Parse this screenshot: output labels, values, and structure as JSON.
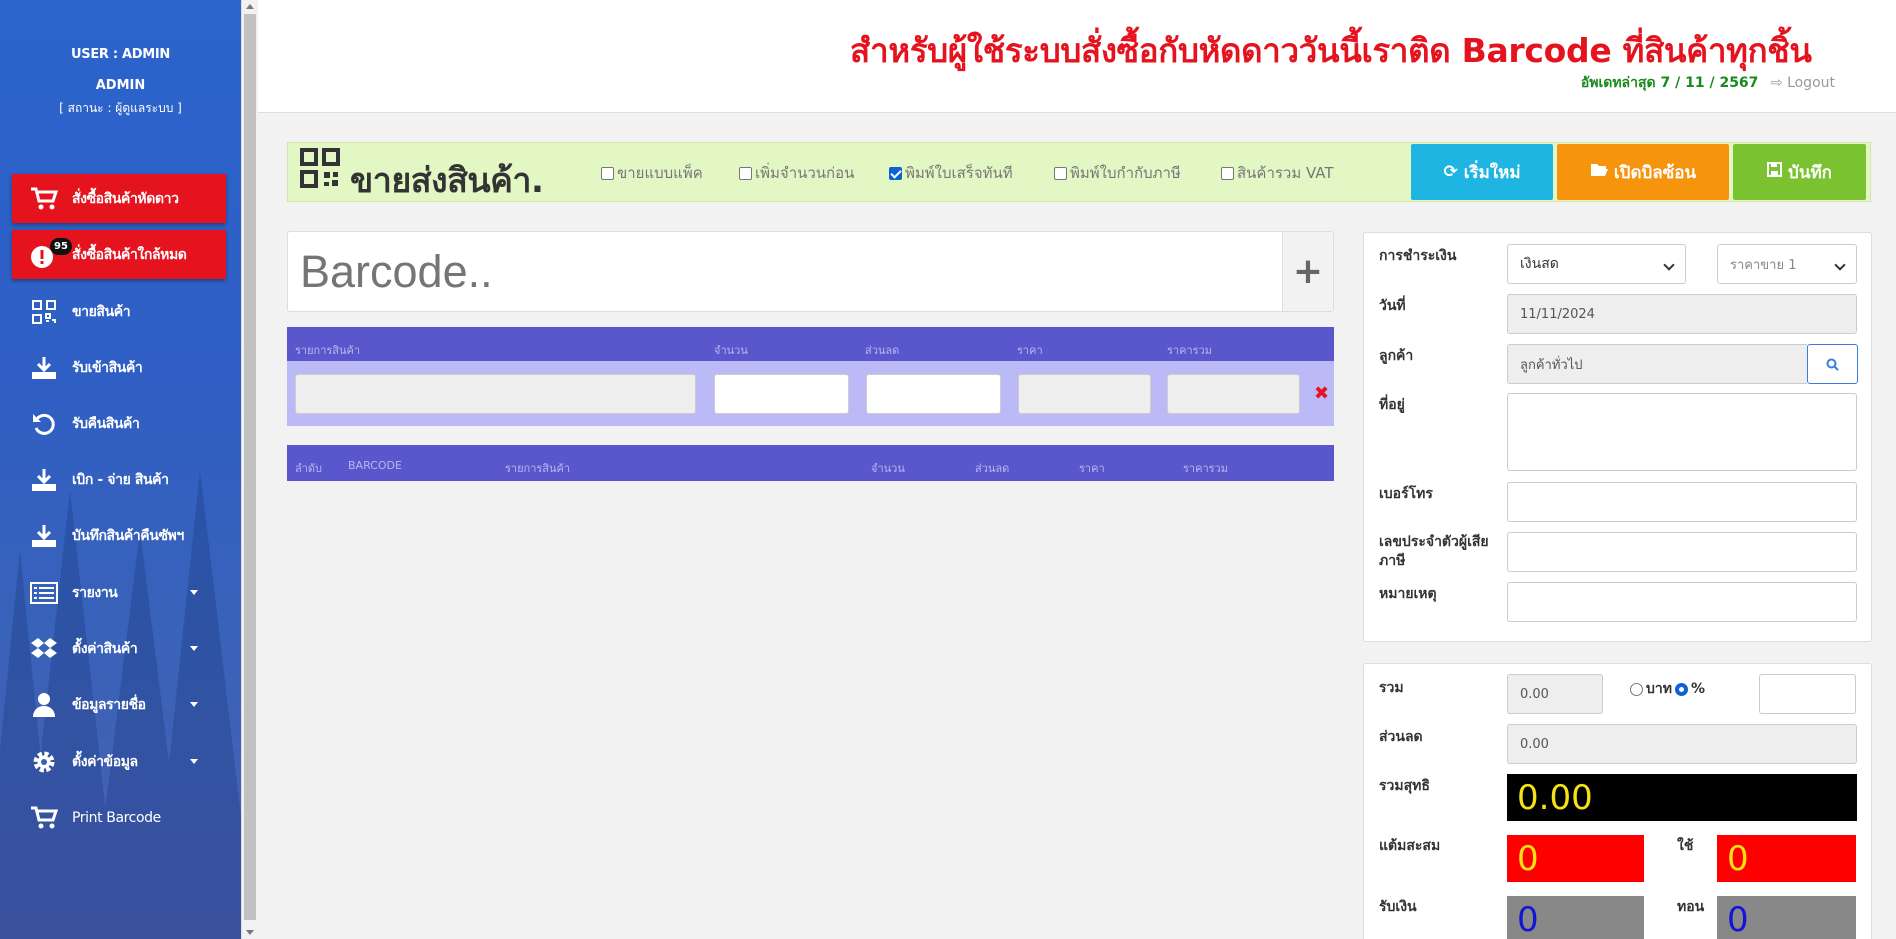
{
  "user": {
    "line1": "USER : ADMIN",
    "line2": "ADMIN",
    "status": "[ สถานะ : ผู้ดูแลระบบ ]"
  },
  "menu": [
    {
      "label": "สั่งซื้อสินค้าหัดดาว",
      "icon": "cart-icon"
    },
    {
      "label": "สั่งซื้อสินค้าใกล้หมด",
      "icon": "alert-icon",
      "badge": "95"
    },
    {
      "label": "ขายสินค้า",
      "icon": "qrcode-icon"
    },
    {
      "label": "รับเข้าสินค้า",
      "icon": "download-icon"
    },
    {
      "label": "รับคืนสินค้า",
      "icon": "undo-icon"
    },
    {
      "label": "เบิก - จ่าย สินค้า",
      "icon": "download-icon"
    },
    {
      "label": "บันทึกสินค้าคืนซัพฯ",
      "icon": "download-icon"
    },
    {
      "label": "รายงาน",
      "icon": "list-icon"
    },
    {
      "label": "ตั้งค่าสินค้า",
      "icon": "dropbox-icon"
    },
    {
      "label": "ข้อมูลรายชื่อ",
      "icon": "user-icon"
    },
    {
      "label": "ตั้งค่าข้อมูล",
      "icon": "gear-icon"
    },
    {
      "label": "Print Barcode",
      "icon": "cart-icon"
    }
  ],
  "header": {
    "marquee": "สำหรับผู้ใช้ระบบสั่งซื้อกับหัดดาววันนี้เราติด Barcode ที่สินค้าทุกชิ้น",
    "updated": "อัพเดทล่าสุด 7 / 11 / 2567",
    "logout": "Logout"
  },
  "titlebar": {
    "title": "ขายส่งสินค้า.",
    "options": [
      {
        "label": "ขายแบบแพ็ค",
        "checked": false
      },
      {
        "label": "เพิ่มจำนวนก่อน",
        "checked": false
      },
      {
        "label": "พิมพ์ใบเสร็จทันที",
        "checked": true
      },
      {
        "label": "พิมพ์ใบกำกับภาษี",
        "checked": false
      },
      {
        "label": "สินค้ารวม VAT",
        "checked": false
      }
    ],
    "buttons": {
      "reset": "เริ่มใหม่",
      "open": "เปิดบิลซ้อน",
      "save": "บันทึก"
    },
    "colors": {
      "reset": "#1fb5e3",
      "open": "#f7940d",
      "save": "#7ac230"
    }
  },
  "barcode": {
    "placeholder": "Barcode.."
  },
  "entry": {
    "headers": [
      "รายการสินค้า",
      "จำนวน",
      "ส่วนลด",
      "ราคา",
      "ราคารวม"
    ]
  },
  "list": {
    "headers": [
      "ลำดับ",
      "BARCODE",
      "รายการสินค้า",
      "จำนวน",
      "ส่วนลด",
      "ราคา",
      "ราคารวม"
    ]
  },
  "customer": {
    "payment_label": "การชำระเงิน",
    "payment_value": "เงินสด",
    "price_level": "ราคาขาย 1",
    "date_label": "วันที่",
    "date_value": "11/11/2024",
    "customer_label": "ลูกค้า",
    "customer_value": "ลูกค้าทั่วไป",
    "address_label": "ที่อยู่",
    "phone_label": "เบอร์โทร",
    "taxid_label": "เลขประจำตัวผู้เสียภาษี",
    "note_label": "หมายเหตุ"
  },
  "totals": {
    "sum_label": "รวม",
    "sum_value": "0.00",
    "baht_label": "บาท",
    "percent_label": "%",
    "percent_selected": true,
    "discount_label": "ส่วนลด",
    "discount_value": "0.00",
    "net_label": "รวมสุทธิ",
    "net_value": "0.00",
    "points_label": "แต้มสะสม",
    "points_value": "0",
    "use_label": "ใช้",
    "use_value": "0",
    "received_label": "รับเงิน",
    "received_value": "0",
    "change_label": "ทอน",
    "change_value": "0"
  }
}
